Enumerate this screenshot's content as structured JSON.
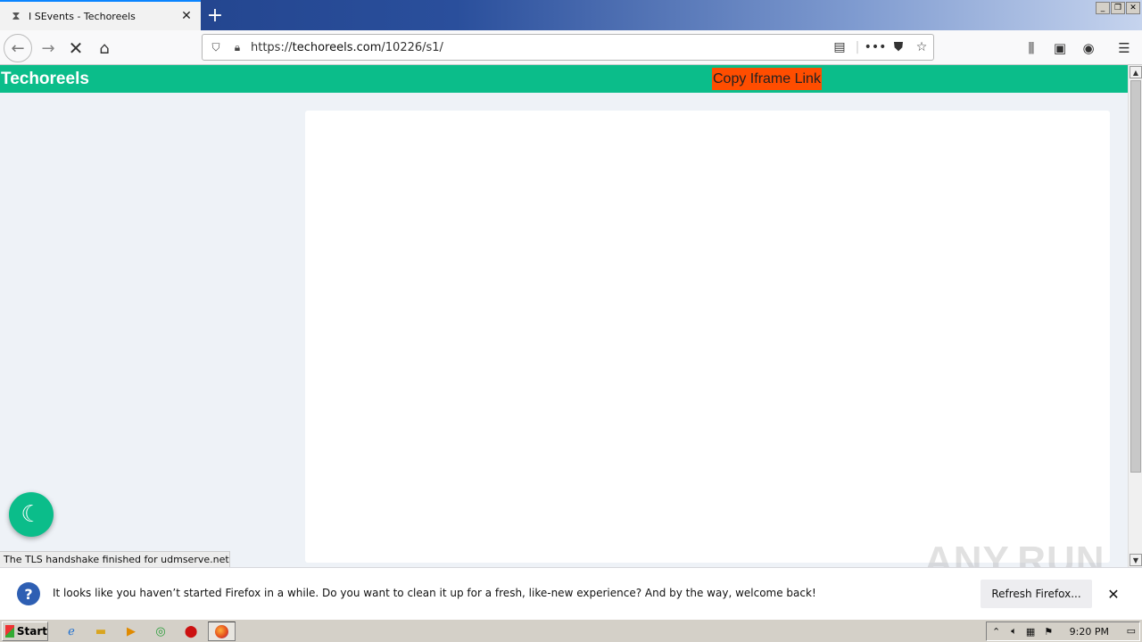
{
  "browser": {
    "tab_title": "I SEvents - Techoreels",
    "url_prefix": "https://",
    "url_host": "techoreels.com",
    "url_path": "/10226/s1/"
  },
  "page": {
    "brand": "Techoreels",
    "copy_button": "Copy Iframe Link",
    "status_text": "The TLS handshake finished for udmserve.net..."
  },
  "notification": {
    "message": "It looks like you haven’t started Firefox in a while. Do you want to clean it up for a fresh, like-new experience? And by the way, welcome back!",
    "refresh_button": "Refresh Firefox..."
  },
  "watermark": "ANY.RUN",
  "taskbar": {
    "start_label": "Start",
    "clock": "9:20 PM"
  },
  "colors": {
    "site_header": "#0bbd8a",
    "copy_button_bg": "#ff4d00",
    "page_bg": "#eef2f7"
  }
}
